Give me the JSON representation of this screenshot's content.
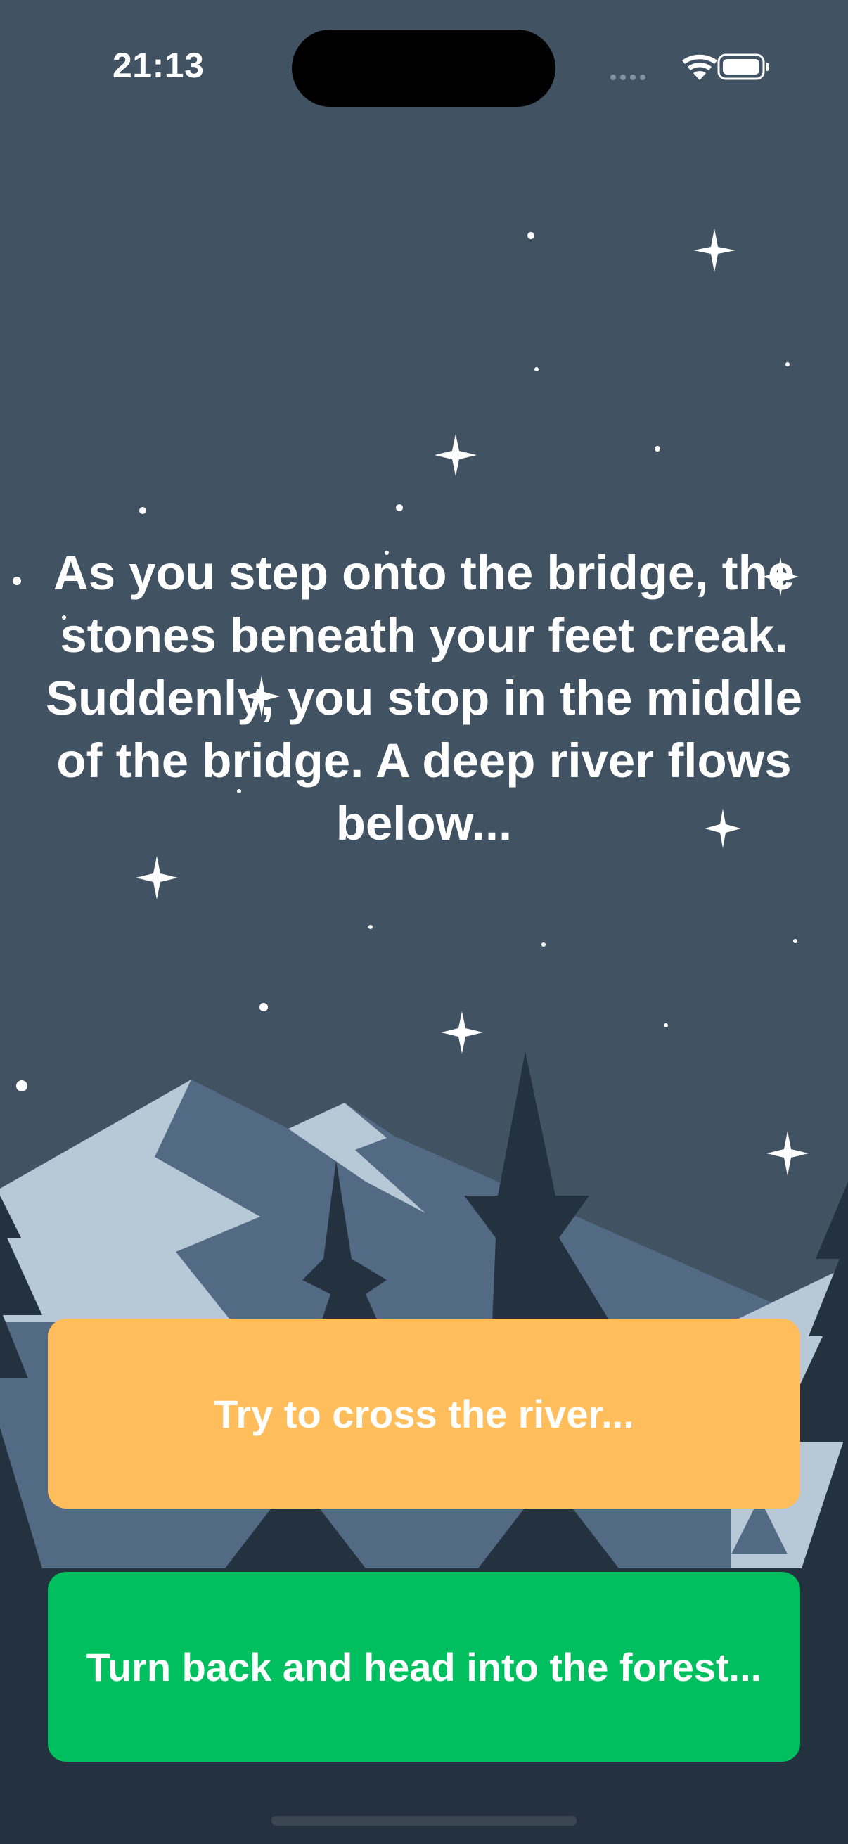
{
  "status_bar": {
    "time": "21:13",
    "icons": [
      "signal-dots-icon",
      "wifi-icon",
      "battery-icon"
    ]
  },
  "story": {
    "text": "As you step onto the bridge, the stones beneath your feet creak. Suddenly, you stop in the middle of the bridge. A deep river flows below..."
  },
  "choices": [
    {
      "label": "Try to cross the river...",
      "color": "#ffbe5b"
    },
    {
      "label": "Turn back and head into the forest...",
      "color": "#00bf5f"
    }
  ],
  "colors": {
    "sky": "#415262",
    "mountain_light": "#b7c8d6",
    "mountain_mid": "#536a85",
    "tree_dark": "#24323f",
    "text": "#ffffff"
  }
}
